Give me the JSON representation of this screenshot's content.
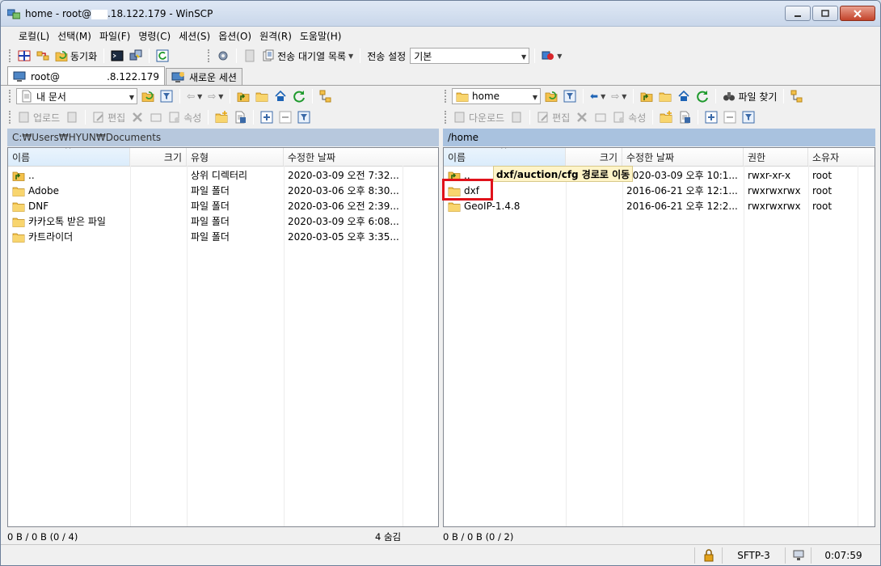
{
  "window": {
    "title_prefix": "home - root@",
    "title_suffix": ".18.122.179 - WinSCP"
  },
  "menu": [
    "로컬(L)",
    "선택(M)",
    "파일(F)",
    "명령(C)",
    "세션(S)",
    "옵션(O)",
    "원격(R)",
    "도움말(H)"
  ],
  "main_toolbar": {
    "sync_label": "동기화",
    "queue_label": "전송 대기열 목록",
    "transfer_settings_label": "전송 설정",
    "transfer_preset": "기본"
  },
  "tabs": [
    {
      "label_prefix": "root@",
      "label_suffix": ".8.122.179",
      "active": true
    },
    {
      "label": "새로운 세션",
      "active": false
    }
  ],
  "local": {
    "location": "내 문서",
    "actions": {
      "upload": "업로드",
      "edit": "편집",
      "properties": "속성"
    },
    "path": "C:₩Users₩HYUN₩Documents",
    "columns": [
      "이름",
      "크기",
      "유형",
      "수정한 날짜"
    ],
    "rows": [
      {
        "name": "..",
        "size": "",
        "type": "상위 디렉터리",
        "modified": "2020-03-09  오전 7:32...",
        "icon": "parent-dir-icon"
      },
      {
        "name": "Adobe",
        "size": "",
        "type": "파일 폴더",
        "modified": "2020-03-06  오후 8:30...",
        "icon": "folder-icon"
      },
      {
        "name": "DNF",
        "size": "",
        "type": "파일 폴더",
        "modified": "2020-03-06  오전 2:39...",
        "icon": "folder-icon"
      },
      {
        "name": "카카오톡 받은 파일",
        "size": "",
        "type": "파일 폴더",
        "modified": "2020-03-09  오후 6:08...",
        "icon": "folder-icon"
      },
      {
        "name": "카트라이더",
        "size": "",
        "type": "파일 폴더",
        "modified": "2020-03-05  오후 3:35...",
        "icon": "folder-icon"
      }
    ],
    "status_left": "0 B / 0 B (0 / 4)",
    "status_right": "4 숨김"
  },
  "remote": {
    "location": "home",
    "find_files_label": "파일 찾기",
    "actions": {
      "download": "다운로드",
      "edit": "편집",
      "properties": "속성"
    },
    "path": "/home",
    "columns": [
      "이름",
      "크기",
      "수정한 날짜",
      "권한",
      "소유자"
    ],
    "rows": [
      {
        "name": "..",
        "size": "",
        "modified": "2020-03-09 오후 10:1...",
        "rights": "rwxr-xr-x",
        "owner": "root",
        "icon": "parent-dir-icon"
      },
      {
        "name": "dxf",
        "size": "",
        "modified": "2016-06-21 오후 12:1...",
        "rights": "rwxrwxrwx",
        "owner": "root",
        "icon": "folder-icon"
      },
      {
        "name": "GeoIP-1.4.8",
        "size": "",
        "modified": "2016-06-21 오후 12:2...",
        "rights": "rwxrwxrwx",
        "owner": "root",
        "icon": "folder-icon"
      }
    ],
    "status_left": "0 B / 0 B (0 / 2)",
    "tooltip": "dxf/auction/cfg 경로로 이동"
  },
  "statusbar": {
    "protocol": "SFTP-3",
    "elapsed": "0:07:59"
  },
  "colors": {
    "active_path_bar": "#a9c2df",
    "inactive_path_bar": "#b7c8dd",
    "highlight_box": "#e0121b",
    "tooltip_bg": "#fff4c8",
    "folder": "#f3c14b"
  }
}
